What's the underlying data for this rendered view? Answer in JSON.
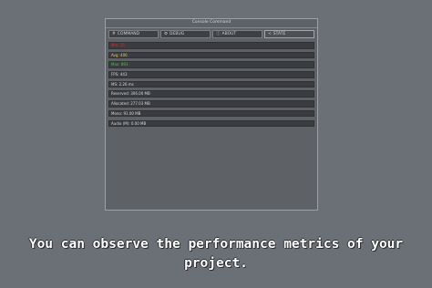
{
  "console": {
    "title": "Console Command",
    "tabs": [
      {
        "icon": "#",
        "label": "COMMAND"
      },
      {
        "icon": "⚙",
        "label": "DEBUG"
      },
      {
        "icon": "ⓘ",
        "label": "ABOUT"
      },
      {
        "icon": "<",
        "label": "STATE"
      }
    ],
    "rows": [
      {
        "text": "Min: 15",
        "color": "#e03030"
      },
      {
        "text": "Avg: 406",
        "color": "#e8c840"
      },
      {
        "text": "Max: 891",
        "color": "#40c840"
      },
      {
        "text": "FPS: 443",
        "color": "#d8d8d8"
      },
      {
        "text": "MS: 2.26 ms",
        "color": "#d8d8d8"
      },
      {
        "text": "Reserved: 306.00 MB",
        "color": "#d8d8d8"
      },
      {
        "text": "Allocated: 277.03 MB",
        "color": "#d8d8d8"
      },
      {
        "text": "Mono: 91.00 MB",
        "color": "#d8d8d8"
      },
      {
        "text": "Audio (M): 0.00 MB",
        "color": "#d8d8d8"
      }
    ]
  },
  "caption": {
    "line1": "You can observe the performance metrics of your",
    "line2": "project."
  }
}
